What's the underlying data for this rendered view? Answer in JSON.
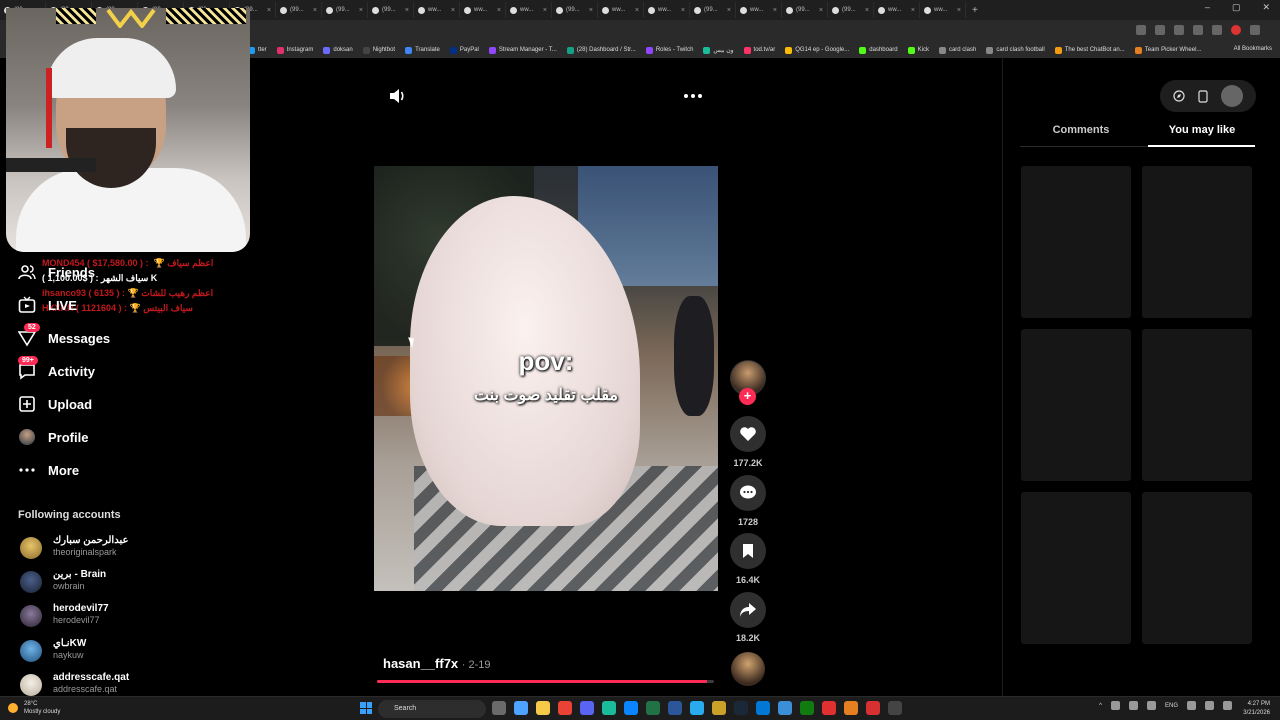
{
  "browser": {
    "tabs": [
      "(99...",
      "(99...",
      "(99...",
      "(99...",
      "(99...",
      "(99...",
      "(99...",
      "(99...",
      "(99...",
      "ww...",
      "ww...",
      "ww...",
      "(99...",
      "ww...",
      "ww...",
      "(99...",
      "ww...",
      "(99...",
      "(99...",
      "ww...",
      "ww..."
    ],
    "new_tab": "+",
    "bookmarks": [
      {
        "label": "tter",
        "color": "#1d9bf0"
      },
      {
        "label": "Instagram",
        "color": "#e1306c"
      },
      {
        "label": "doksan",
        "color": "#6b6bff"
      },
      {
        "label": "Nightbot",
        "color": "#444"
      },
      {
        "label": "Translate",
        "color": "#4285f4"
      },
      {
        "label": "PayPal",
        "color": "#003087"
      },
      {
        "label": "Stream Manager - T...",
        "color": "#9146ff"
      },
      {
        "label": "(28) Dashboard / Str...",
        "color": "#16a085"
      },
      {
        "label": "Roles - Twitch",
        "color": "#9146ff"
      },
      {
        "label": "ون بيس",
        "color": "#1abc9c"
      },
      {
        "label": "tod.tv/ar",
        "color": "#ff3366"
      },
      {
        "label": "QG14 ep - Google...",
        "color": "#fbbc05"
      },
      {
        "label": "dashboard",
        "color": "#53fc18"
      },
      {
        "label": "Kick",
        "color": "#53fc18"
      },
      {
        "label": "card clash",
        "color": "#888"
      },
      {
        "label": "card clash football",
        "color": "#888"
      },
      {
        "label": "The best ChatBot an...",
        "color": "#f39c12"
      },
      {
        "label": "Team Picker Wheel...",
        "color": "#e67e22"
      }
    ],
    "all_bookmarks": "All Bookmarks"
  },
  "overlay": {
    "lines": [
      {
        "text": "MOND454 ( $17,580.00 ) : ‍ 🏆 اعظم سياف",
        "style": "red"
      },
      {
        "text": "سياف الشهر : ( $1,100.00 ) K",
        "style": "white"
      },
      {
        "text": "ihsanco93 ( 6135 ) : 🏆 اعظم رهيب للشات",
        "style": "red"
      },
      {
        "text": "HXXKR ( 1121604 ) : 🏆 سياف البيتس",
        "style": "red"
      }
    ]
  },
  "sidebar": {
    "items": [
      {
        "label": "Friends",
        "icon": "friends-icon"
      },
      {
        "label": "LIVE",
        "icon": "live-icon"
      },
      {
        "label": "Messages",
        "icon": "messages-icon",
        "badge": "52"
      },
      {
        "label": "Activity",
        "icon": "activity-icon",
        "badge": "99+"
      },
      {
        "label": "Upload",
        "icon": "upload-icon"
      },
      {
        "label": "Profile",
        "icon": "profile-avatar"
      },
      {
        "label": "More",
        "icon": "more-icon"
      }
    ],
    "following_title": "Following accounts",
    "accounts": [
      {
        "name": "عبدالرحمن سبارك",
        "username": "theoriginalspark",
        "color": "#c9a24a"
      },
      {
        "name": "برين - Brain",
        "username": "owbrain",
        "color": "#2c3e6b"
      },
      {
        "name": "herodevil77",
        "username": "herodevil77",
        "color": "#5b4a6b"
      },
      {
        "name": "نـايKW",
        "username": "naykuw",
        "color": "#3a7fc0"
      },
      {
        "name": "addresscafe.qat",
        "username": "addresscafe.qat",
        "color": "#e8e2d8"
      }
    ]
  },
  "video": {
    "overlay_line1": "pov:",
    "overlay_line2": "مقلب تقليد صوت بنت",
    "author": "hasan__ff7x",
    "date": "· 2-19",
    "progress": 0.98,
    "follow_symbol": "+",
    "likes": "177.2K",
    "comments": "1728",
    "saves": "16.4K",
    "shares": "18.2K"
  },
  "right_panel": {
    "tabs": {
      "comments": "Comments",
      "you_may_like": "You may like"
    },
    "active_tab": "you_may_like"
  },
  "taskbar": {
    "weather_temp": "28°C",
    "weather_desc": "Mostly cloudy",
    "search": "Search",
    "lang": "ENG",
    "time": "4:27 PM",
    "date": "3/21/2026"
  }
}
